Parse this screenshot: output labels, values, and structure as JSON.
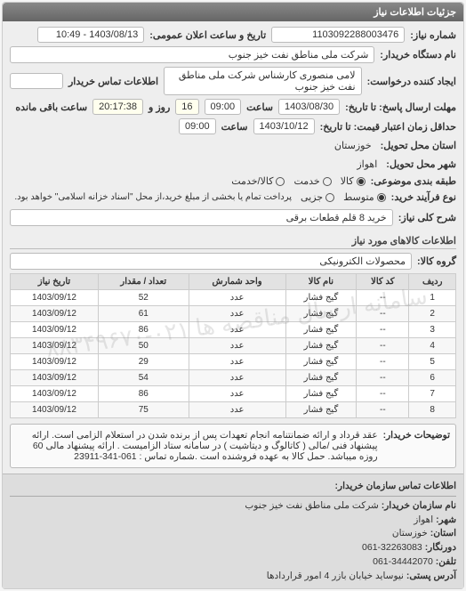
{
  "header": {
    "title": "جزئیات اطلاعات نیاز"
  },
  "info": {
    "req_no_label": "شماره نیاز:",
    "req_no": "1103092288003476",
    "pub_time_label": "تاریخ و ساعت اعلان عمومی:",
    "pub_time": "1403/08/13 - 10:49",
    "org_label": "نام دستگاه خریدار:",
    "org": "شرکت ملی مناطق نفت خیز جنوب",
    "requester_label": "ایجاد کننده درخواست:",
    "requester": "لامی منصوری کارشناس شرکت ملی مناطق نفت خیز جنوب",
    "contact_label": "اطلاعات تماس خریدار",
    "contact": "",
    "deadline_send_label": "مهلت ارسال پاسخ: تا تاریخ:",
    "deadline_send_date": "1403/08/30",
    "deadline_send_time_label": "ساعت",
    "deadline_send_time": "09:00",
    "days_remaining": "16",
    "days_remaining_label": "روز و",
    "time_remaining": "20:17:38",
    "time_remaining_label": "ساعت باقی مانده",
    "validity_label": "حداقل زمان اعتبار قیمت: تا تاریخ:",
    "validity_date": "1403/10/12",
    "validity_time_label": "ساعت",
    "validity_time": "09:00",
    "province_label": "استان محل تحویل:",
    "province": "خوزستان",
    "city_label": "شهر محل تحویل:",
    "city": "اهواز",
    "classify_label": "طبقه بندی موضوعی:",
    "classify_options": [
      "کالا",
      "خدمت",
      "کالا/خدمت"
    ],
    "classify_selected": 0,
    "process_label": "نوع فرآیند خرید:",
    "process_options": [
      "متوسط",
      "جزیی"
    ],
    "process_selected": 0,
    "process_note": "پرداخت تمام یا بخشی از مبلغ خرید،از محل \"اسناد خزانه اسلامی\" خواهد بود.",
    "desc_label": "شرح کلی نیاز:",
    "desc": "خرید 8 قلم قطعات برقی",
    "items_header": "اطلاعات کالاهای مورد نیاز",
    "group_label": "گروه کالا:",
    "group": "محصولات الکترونیکی"
  },
  "table": {
    "columns": [
      "ردیف",
      "کد کالا",
      "نام کالا",
      "واحد شمارش",
      "تعداد / مقدار",
      "تاریخ نیاز"
    ],
    "rows": [
      [
        "1",
        "--",
        "گیج فشار",
        "عدد",
        "52",
        "1403/09/12"
      ],
      [
        "2",
        "--",
        "گیج فشار",
        "عدد",
        "61",
        "1403/09/12"
      ],
      [
        "3",
        "--",
        "گیج فشار",
        "عدد",
        "86",
        "1403/09/12"
      ],
      [
        "4",
        "--",
        "گیج فشار",
        "عدد",
        "50",
        "1403/09/12"
      ],
      [
        "5",
        "--",
        "گیج فشار",
        "عدد",
        "29",
        "1403/09/12"
      ],
      [
        "6",
        "--",
        "گیج فشار",
        "عدد",
        "54",
        "1403/09/12"
      ],
      [
        "7",
        "--",
        "گیج فشار",
        "عدد",
        "86",
        "1403/09/12"
      ],
      [
        "8",
        "--",
        "گیج فشار",
        "عدد",
        "75",
        "1403/09/12"
      ]
    ],
    "watermark": "سامانه ارسال مناقصه ها ۰۲۱-۸۸۳۴۹۶۷۰"
  },
  "note": {
    "label": "توضیحات خریدار:",
    "text": "عقد قرداد و ارائه ضمانتنامه انجام تعهدات پس از برنده شدن در استعلام الزامی است. ارائه پیشنهاد فنی /مالی ( کاتالوگ و دیتاشیت ) در سامانه ستاد الزامیست . ارائه پیشنهاد مالی 60 روزه میباشد. حمل کالا به عهده فروشنده است .شماره تماس : 061-341-23911"
  },
  "footer": {
    "title": "اطلاعات تماس سازمان خریدار:",
    "org_label": "نام سازمان خریدار:",
    "org": "شرکت ملی مناطق نفت خیز جنوب",
    "city_label": "شهر:",
    "city": "اهواز",
    "province_label": "استان:",
    "province": "خوزستان",
    "fax_label": "دورنگار:",
    "fax": "32263083-061",
    "phone_label": "تلفن:",
    "phone": "34442070-061",
    "address_label": "آدرس پستی:",
    "address": "نیوساید خیابان بازر 4 امور قراردادها"
  }
}
